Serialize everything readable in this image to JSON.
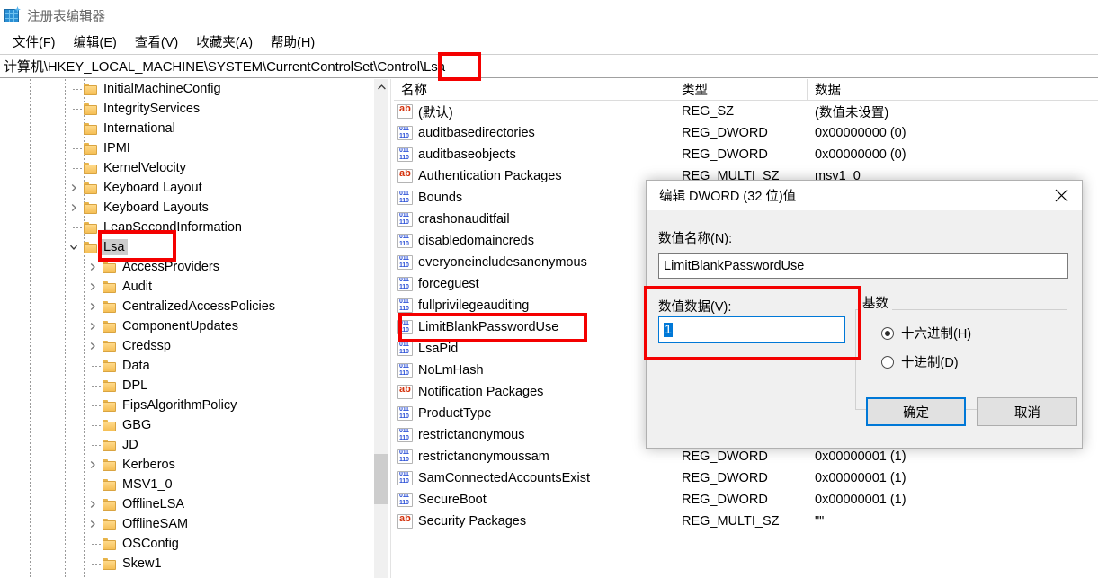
{
  "window": {
    "title": "注册表编辑器",
    "icon": "registry-editor-icon",
    "menu": [
      "文件(F)",
      "编辑(E)",
      "查看(V)",
      "收藏夹(A)",
      "帮助(H)"
    ],
    "address": "计算机\\HKEY_LOCAL_MACHINE\\SYSTEM\\CurrentControlSet\\Control\\Lsa"
  },
  "tree": {
    "items": [
      {
        "label": "InitialMachineConfig",
        "depth": 3,
        "expander": "none",
        "selected": false
      },
      {
        "label": "IntegrityServices",
        "depth": 3,
        "expander": "none",
        "selected": false
      },
      {
        "label": "International",
        "depth": 3,
        "expander": "none",
        "selected": false
      },
      {
        "label": "IPMI",
        "depth": 3,
        "expander": "none",
        "selected": false
      },
      {
        "label": "KernelVelocity",
        "depth": 3,
        "expander": "none",
        "selected": false
      },
      {
        "label": "Keyboard Layout",
        "depth": 3,
        "expander": "collapsed",
        "selected": false
      },
      {
        "label": "Keyboard Layouts",
        "depth": 3,
        "expander": "collapsed",
        "selected": false
      },
      {
        "label": "LeapSecondInformation",
        "depth": 3,
        "expander": "none",
        "selected": false
      },
      {
        "label": "Lsa",
        "depth": 3,
        "expander": "expanded",
        "selected": true
      },
      {
        "label": "AccessProviders",
        "depth": 4,
        "expander": "collapsed",
        "selected": false
      },
      {
        "label": "Audit",
        "depth": 4,
        "expander": "collapsed",
        "selected": false
      },
      {
        "label": "CentralizedAccessPolicies",
        "depth": 4,
        "expander": "collapsed",
        "selected": false
      },
      {
        "label": "ComponentUpdates",
        "depth": 4,
        "expander": "collapsed",
        "selected": false
      },
      {
        "label": "Credssp",
        "depth": 4,
        "expander": "collapsed",
        "selected": false
      },
      {
        "label": "Data",
        "depth": 4,
        "expander": "none",
        "selected": false
      },
      {
        "label": "DPL",
        "depth": 4,
        "expander": "none",
        "selected": false
      },
      {
        "label": "FipsAlgorithmPolicy",
        "depth": 4,
        "expander": "none",
        "selected": false
      },
      {
        "label": "GBG",
        "depth": 4,
        "expander": "none",
        "selected": false
      },
      {
        "label": "JD",
        "depth": 4,
        "expander": "none",
        "selected": false
      },
      {
        "label": "Kerberos",
        "depth": 4,
        "expander": "collapsed",
        "selected": false
      },
      {
        "label": "MSV1_0",
        "depth": 4,
        "expander": "none",
        "selected": false
      },
      {
        "label": "OfflineLSA",
        "depth": 4,
        "expander": "collapsed",
        "selected": false
      },
      {
        "label": "OfflineSAM",
        "depth": 4,
        "expander": "collapsed",
        "selected": false
      },
      {
        "label": "OSConfig",
        "depth": 4,
        "expander": "none",
        "selected": false
      },
      {
        "label": "Skew1",
        "depth": 4,
        "expander": "none",
        "selected": false
      }
    ]
  },
  "list": {
    "columns": [
      "名称",
      "类型",
      "数据"
    ],
    "rows": [
      {
        "name": "(默认)",
        "icon": "string-value-icon",
        "type": "REG_SZ",
        "data": "(数值未设置)"
      },
      {
        "name": "auditbasedirectories",
        "icon": "dword-value-icon",
        "type": "REG_DWORD",
        "data": "0x00000000 (0)"
      },
      {
        "name": "auditbaseobjects",
        "icon": "dword-value-icon",
        "type": "REG_DWORD",
        "data": "0x00000000 (0)"
      },
      {
        "name": "Authentication Packages",
        "icon": "string-value-icon",
        "type": "REG_MULTI_SZ",
        "data": "msv1_0"
      },
      {
        "name": "Bounds",
        "icon": "dword-value-icon",
        "type": "",
        "data": ""
      },
      {
        "name": "crashonauditfail",
        "icon": "dword-value-icon",
        "type": "",
        "data": ""
      },
      {
        "name": "disabledomaincreds",
        "icon": "dword-value-icon",
        "type": "",
        "data": ""
      },
      {
        "name": "everyoneincludesanonymous",
        "icon": "dword-value-icon",
        "type": "",
        "data": ""
      },
      {
        "name": "forceguest",
        "icon": "dword-value-icon",
        "type": "",
        "data": ""
      },
      {
        "name": "fullprivilegeauditing",
        "icon": "dword-value-icon",
        "type": "",
        "data": ""
      },
      {
        "name": "LimitBlankPasswordUse",
        "icon": "dword-value-icon",
        "type": "",
        "data": ""
      },
      {
        "name": "LsaPid",
        "icon": "dword-value-icon",
        "type": "",
        "data": ""
      },
      {
        "name": "NoLmHash",
        "icon": "dword-value-icon",
        "type": "",
        "data": ""
      },
      {
        "name": "Notification Packages",
        "icon": "string-value-icon",
        "type": "",
        "data": ""
      },
      {
        "name": "ProductType",
        "icon": "dword-value-icon",
        "type": "",
        "data": ""
      },
      {
        "name": "restrictanonymous",
        "icon": "dword-value-icon",
        "type": "",
        "data": ""
      },
      {
        "name": "restrictanonymoussam",
        "icon": "dword-value-icon",
        "type": "REG_DWORD",
        "data": "0x00000001 (1)"
      },
      {
        "name": "SamConnectedAccountsExist",
        "icon": "dword-value-icon",
        "type": "REG_DWORD",
        "data": "0x00000001 (1)"
      },
      {
        "name": "SecureBoot",
        "icon": "dword-value-icon",
        "type": "REG_DWORD",
        "data": "0x00000001 (1)"
      },
      {
        "name": "Security Packages",
        "icon": "string-value-icon",
        "type": "REG_MULTI_SZ",
        "data": "\"\""
      }
    ]
  },
  "dialog": {
    "title": "编辑 DWORD (32 位)值",
    "close_icon": "close-icon",
    "value_name_label": "数值名称(N):",
    "value_name": "LimitBlankPasswordUse",
    "value_data_label": "数值数据(V):",
    "value_data": "1",
    "base_legend": "基数",
    "base_options": [
      {
        "label": "十六进制(H)",
        "selected": true
      },
      {
        "label": "十进制(D)",
        "selected": false
      }
    ],
    "ok_label": "确定",
    "cancel_label": "取消"
  },
  "annotations": {
    "color": "#f40000",
    "boxes": [
      "address-lsa",
      "tree-lsa-node",
      "list-row-limitblankpassworduse",
      "dialog-value-data"
    ]
  }
}
